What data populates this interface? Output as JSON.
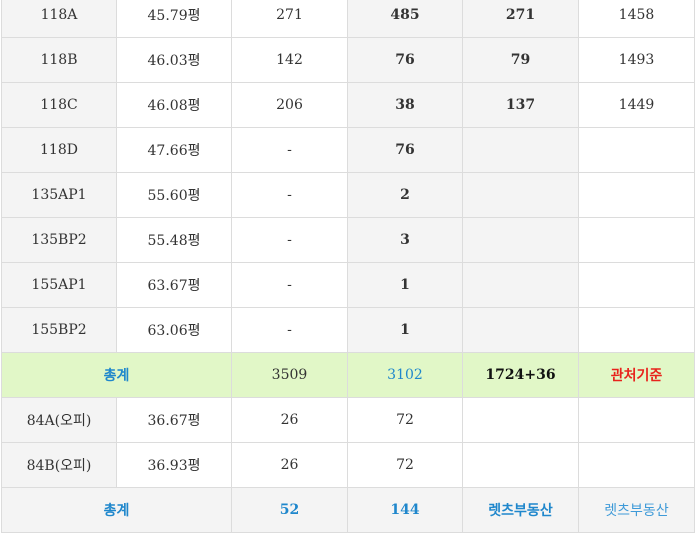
{
  "rows": [
    {
      "type": "118A",
      "area": "45.79평",
      "a": "271",
      "b": "485",
      "c": "271",
      "d": "1458"
    },
    {
      "type": "118B",
      "area": "46.03평",
      "a": "142",
      "b": "76",
      "c": "79",
      "d": "1493"
    },
    {
      "type": "118C",
      "area": "46.08평",
      "a": "206",
      "b": "38",
      "c": "137",
      "d": "1449"
    },
    {
      "type": "118D",
      "area": "47.66평",
      "a": "-",
      "b": "76",
      "c": "",
      "d": ""
    },
    {
      "type": "135AP1",
      "area": "55.60평",
      "a": "-",
      "b": "2",
      "c": "",
      "d": ""
    },
    {
      "type": "135BP2",
      "area": "55.48평",
      "a": "-",
      "b": "3",
      "c": "",
      "d": ""
    },
    {
      "type": "155AP1",
      "area": "63.67평",
      "a": "-",
      "b": "1",
      "c": "",
      "d": ""
    },
    {
      "type": "155BP2",
      "area": "63.06평",
      "a": "-",
      "b": "1",
      "c": "",
      "d": ""
    }
  ],
  "total1": {
    "label": "총계",
    "a": "3509",
    "b": "3102",
    "c": "1724+36",
    "d": "관처기준"
  },
  "officetel_rows": [
    {
      "type": "84A(오피)",
      "area": "36.67평",
      "a": "26",
      "b": "72",
      "c": "",
      "d": ""
    },
    {
      "type": "84B(오피)",
      "area": "36.93평",
      "a": "26",
      "b": "72",
      "c": "",
      "d": ""
    }
  ],
  "total2": {
    "label": "총계",
    "a": "52",
    "b": "144",
    "c": "렛츠부동산",
    "d": "렛츠부동산"
  },
  "colors": {
    "blue": "#1f87cc",
    "green_band": "#e1f7c7",
    "red": "#e8231c",
    "grey_cell": "#f4f4f4",
    "border": "#dcdcdc"
  }
}
